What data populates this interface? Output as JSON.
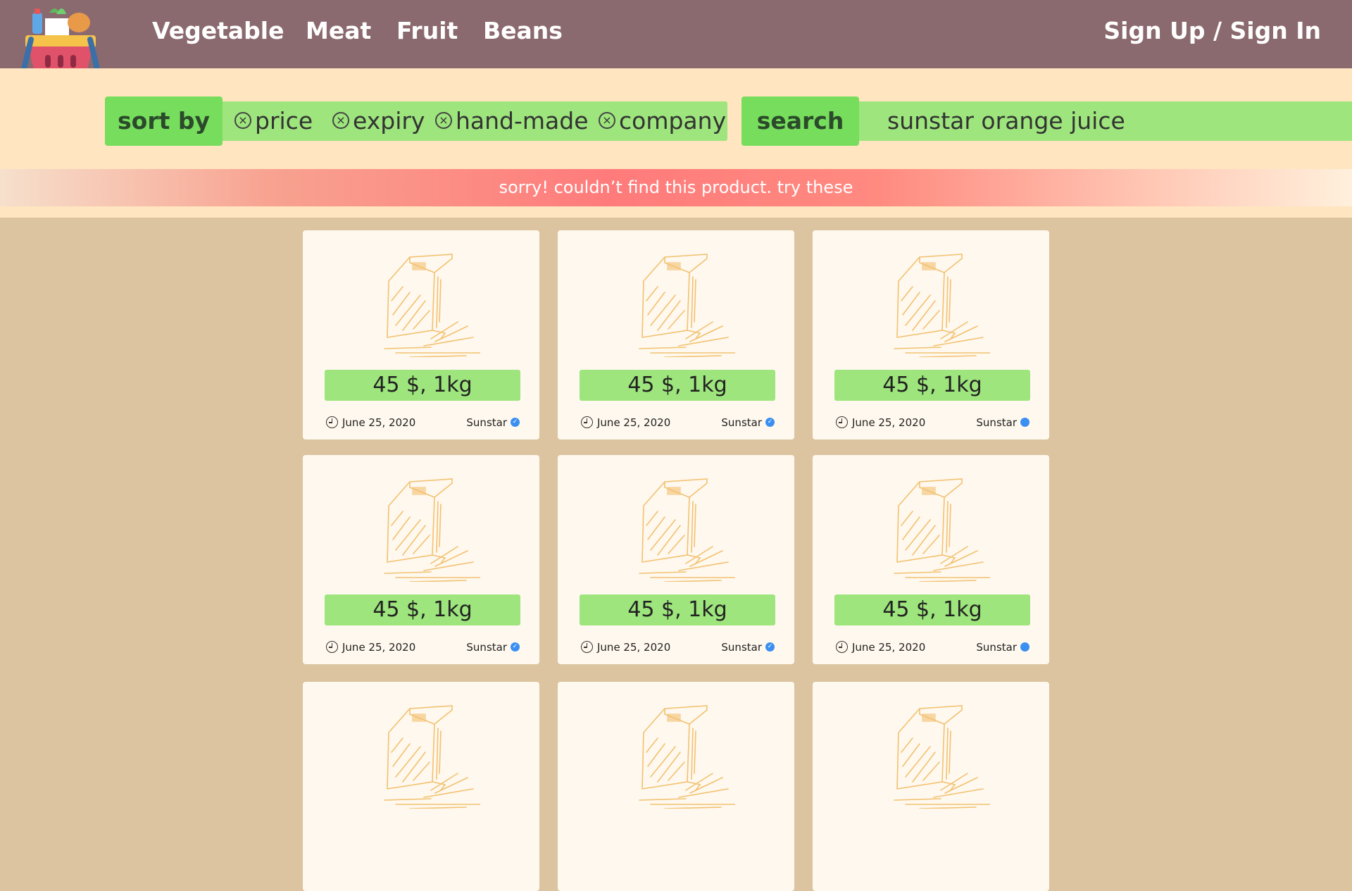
{
  "nav": {
    "items": [
      "Vegetable",
      "Meat",
      "Fruit",
      "Beans"
    ],
    "signin_label": "Sign Up / Sign In"
  },
  "filters": {
    "sort_label": "sort by",
    "chips": [
      "price",
      "expiry",
      "hand-made",
      "company"
    ]
  },
  "search": {
    "button_label": "search",
    "value": "sunstar orange juice"
  },
  "notice": "sorry! couldn’t find this product. try these",
  "products": [
    {
      "price": "45 $, 1kg",
      "date": "June 25, 2020",
      "vendor": "Sunstar",
      "verified": true
    },
    {
      "price": "45 $, 1kg",
      "date": "June 25, 2020",
      "vendor": "Sunstar",
      "verified": true
    },
    {
      "price": "45 $, 1kg",
      "date": "June 25, 2020",
      "vendor": "Sunstar",
      "verified": false
    },
    {
      "price": "45 $, 1kg",
      "date": "June 25, 2020",
      "vendor": "Sunstar",
      "verified": true
    },
    {
      "price": "45 $, 1kg",
      "date": "June 25, 2020",
      "vendor": "Sunstar",
      "verified": true
    },
    {
      "price": "45 $, 1kg",
      "date": "June 25, 2020",
      "vendor": "Sunstar",
      "verified": false
    },
    {
      "price": "",
      "date": "",
      "vendor": "",
      "verified": false
    },
    {
      "price": "",
      "date": "",
      "vendor": "",
      "verified": false
    },
    {
      "price": "",
      "date": "",
      "vendor": "",
      "verified": false
    }
  ],
  "colors": {
    "header": "#8b6a6f",
    "filter_band": "#ffe5c0",
    "accent_green": "#9de57c",
    "button_green": "#77dd5c",
    "notice_red": "#ff7b7b",
    "page_bg": "#dbc49f",
    "card_bg": "#fff8ee",
    "verified_badge": "#3a8ff0"
  },
  "icons": {
    "logo": "grocery-basket-logo",
    "chip_remove": "circle-x-icon",
    "date": "clock-icon",
    "verified": "verified-check-icon",
    "product_image": "juice-carton-sketch"
  }
}
